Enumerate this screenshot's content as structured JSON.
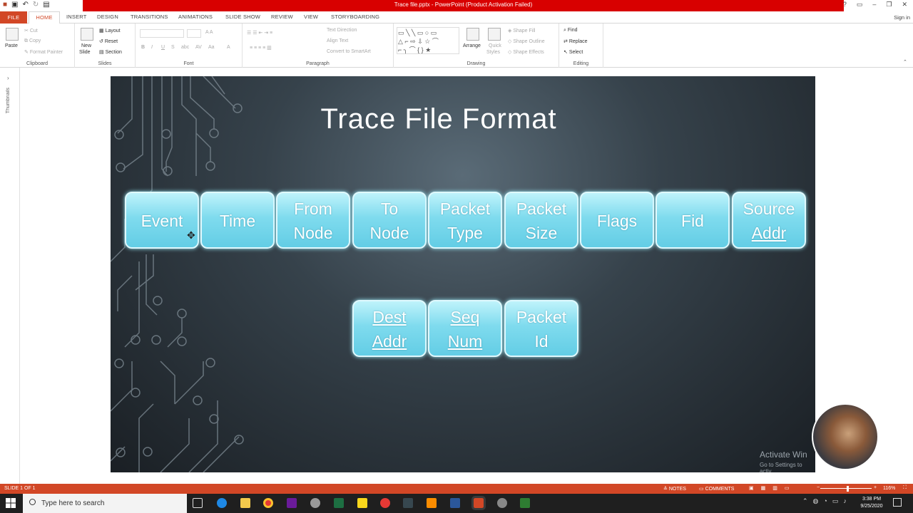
{
  "window": {
    "title": "Trace file.pptx - PowerPoint (Product Activation Failed)",
    "signin": "Sign in"
  },
  "tabs": [
    "FILE",
    "HOME",
    "INSERT",
    "DESIGN",
    "TRANSITIONS",
    "ANIMATIONS",
    "SLIDE SHOW",
    "REVIEW",
    "VIEW",
    "STORYBOARDING"
  ],
  "ribbon": {
    "clipboard": {
      "label": "Clipboard",
      "paste": "Paste",
      "cut": "Cut",
      "copy": "Copy",
      "format_painter": "Format Painter"
    },
    "slides": {
      "label": "Slides",
      "new_slide_1": "New",
      "new_slide_2": "Slide",
      "layout": "Layout",
      "reset": "Reset",
      "section": "Section"
    },
    "font": {
      "label": "Font"
    },
    "paragraph": {
      "label": "Paragraph",
      "text_direction": "Text Direction",
      "align_text": "Align Text",
      "convert": "Convert to SmartArt"
    },
    "drawing": {
      "label": "Drawing",
      "arrange": "Arrange",
      "quick_styles_1": "Quick",
      "quick_styles_2": "Styles",
      "shape_fill": "Shape Fill",
      "shape_outline": "Shape Outline",
      "shape_effects": "Shape Effects"
    },
    "editing": {
      "label": "Editing",
      "find": "Find",
      "replace": "Replace",
      "select": "Select"
    }
  },
  "left_panel": {
    "label": "Thumbnails"
  },
  "slide": {
    "title": "Trace File Format",
    "row1": [
      {
        "l1": "Event",
        "l2": ""
      },
      {
        "l1": "Time",
        "l2": ""
      },
      {
        "l1": "From",
        "l2": "Node"
      },
      {
        "l1": "To",
        "l2": "Node"
      },
      {
        "l1": "Packet",
        "l2": "Type"
      },
      {
        "l1": "Packet",
        "l2": "Size"
      },
      {
        "l1": "Flags",
        "l2": ""
      },
      {
        "l1": "Fid",
        "l2": ""
      },
      {
        "l1": "Source",
        "l2": "Addr"
      }
    ],
    "row2": [
      {
        "l1": "Dest",
        "l2": "Addr"
      },
      {
        "l1": "Seq",
        "l2": "Num"
      },
      {
        "l1": "Packet",
        "l2": "Id"
      }
    ]
  },
  "watermark": {
    "line1": "Activate Win",
    "line2": "Go to Settings to activ"
  },
  "statusbar": {
    "slide": "SLIDE 1 OF 1",
    "notes": "NOTES",
    "comments": "COMMENTS",
    "zoom": "116%"
  },
  "taskbar": {
    "search_placeholder": "Type here to search",
    "time": "3:38 PM",
    "date": "9/25/2020"
  },
  "colors": {
    "accent": "#d24726",
    "title_bar": "#d80000",
    "box_fill": "#7fdbee"
  }
}
